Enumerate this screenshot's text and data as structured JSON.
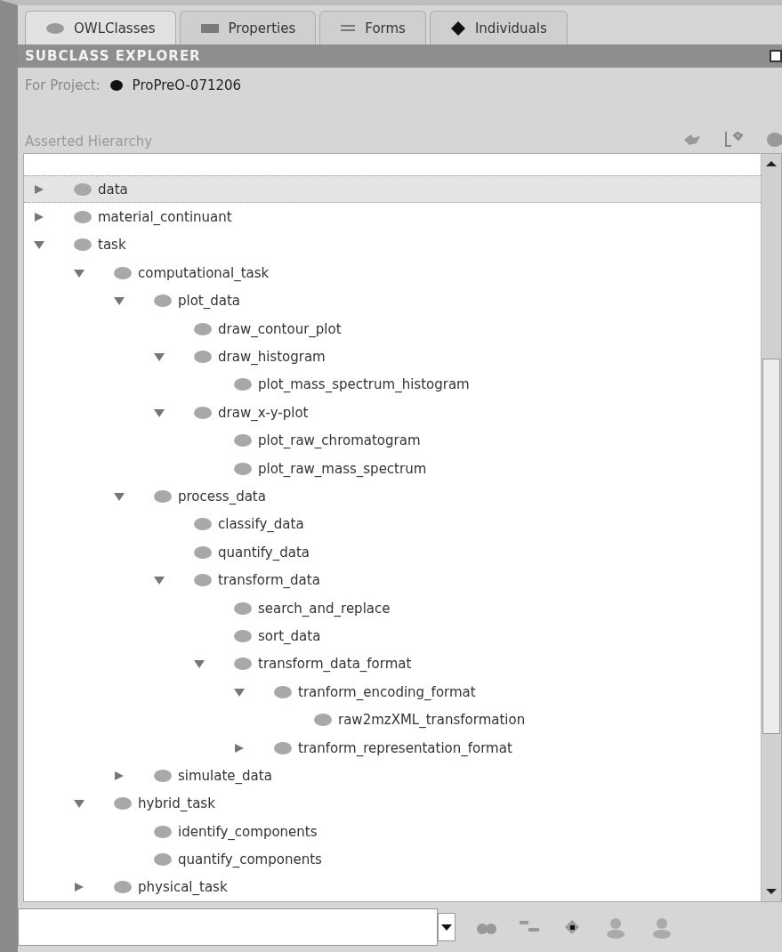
{
  "tabs": [
    {
      "label": "OWLClasses",
      "kind": "classes",
      "selected": true
    },
    {
      "label": "Properties",
      "kind": "properties",
      "selected": false
    },
    {
      "label": "Forms",
      "kind": "forms",
      "selected": false
    },
    {
      "label": "Individuals",
      "kind": "individuals",
      "selected": false
    }
  ],
  "panel": {
    "title": "SUBCLASS EXPLORER",
    "project_label": "For Project:",
    "project_name": "ProPreO-071206",
    "hierarchy_label": "Asserted Hierarchy"
  },
  "tree": [
    {
      "label": "data",
      "expanded": false,
      "selected": true
    },
    {
      "label": "material_continuant",
      "expanded": false,
      "selected": false
    },
    {
      "label": "task",
      "expanded": true,
      "selected": false,
      "children": [
        {
          "label": "computational_task",
          "expanded": true,
          "selected": false,
          "children": [
            {
              "label": "plot_data",
              "expanded": true,
              "selected": false,
              "children": [
                {
                  "label": "draw_contour_plot",
                  "selected": false
                },
                {
                  "label": "draw_histogram",
                  "expanded": true,
                  "selected": false,
                  "children": [
                    {
                      "label": "plot_mass_spectrum_histogram",
                      "selected": false
                    }
                  ]
                },
                {
                  "label": "draw_x-y-plot",
                  "expanded": true,
                  "selected": false,
                  "children": [
                    {
                      "label": "plot_raw_chromatogram",
                      "selected": false
                    },
                    {
                      "label": "plot_raw_mass_spectrum",
                      "selected": false
                    }
                  ]
                }
              ]
            },
            {
              "label": "process_data",
              "expanded": true,
              "selected": false,
              "children": [
                {
                  "label": "classify_data",
                  "selected": false
                },
                {
                  "label": "quantify_data",
                  "selected": false
                },
                {
                  "label": "transform_data",
                  "expanded": true,
                  "selected": false,
                  "children": [
                    {
                      "label": "search_and_replace",
                      "selected": false
                    },
                    {
                      "label": "sort_data",
                      "selected": false
                    },
                    {
                      "label": "transform_data_format",
                      "expanded": true,
                      "selected": false,
                      "children": [
                        {
                          "label": "tranform_encoding_format",
                          "expanded": true,
                          "selected": false,
                          "children": [
                            {
                              "label": "raw2mzXML_transformation",
                              "selected": false
                            }
                          ]
                        },
                        {
                          "label": "tranform_representation_format",
                          "expanded": false,
                          "selected": false
                        }
                      ]
                    }
                  ]
                }
              ]
            },
            {
              "label": "simulate_data",
              "expanded": false,
              "selected": false
            }
          ]
        },
        {
          "label": "hybrid_task",
          "expanded": true,
          "selected": false,
          "children": [
            {
              "label": "identify_components",
              "selected": false
            },
            {
              "label": "quantify_components",
              "selected": false
            }
          ]
        },
        {
          "label": "physical_task",
          "expanded": false,
          "selected": false
        }
      ]
    }
  ]
}
